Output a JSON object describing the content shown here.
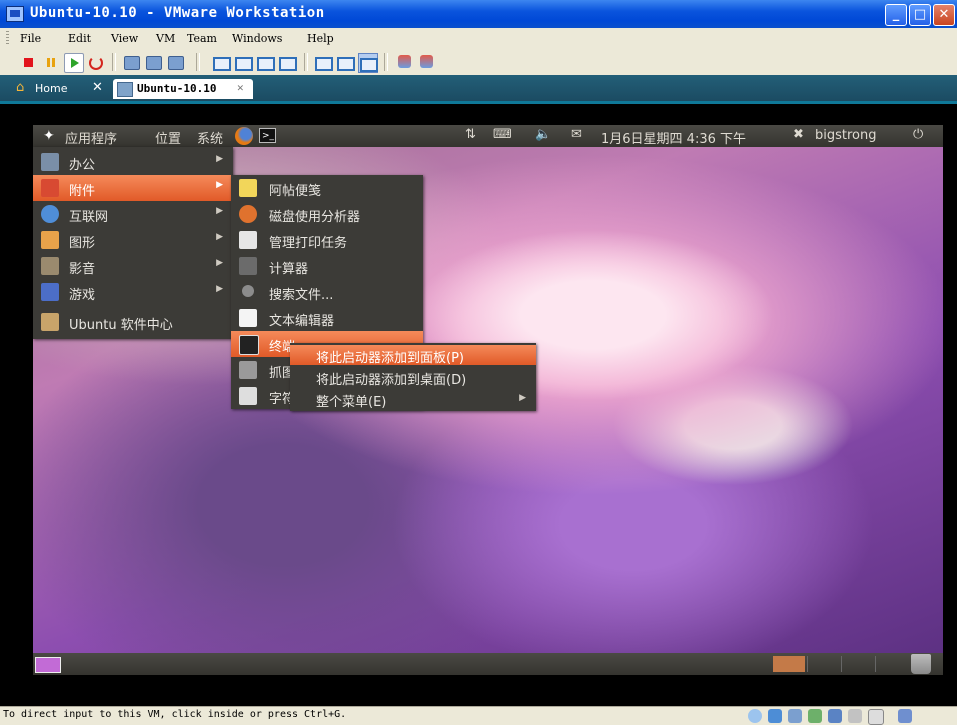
{
  "window": {
    "title": "Ubuntu-10.10 - VMware Workstation"
  },
  "menubar": [
    "File",
    "Edit",
    "View",
    "VM",
    "Team",
    "Windows",
    "Help"
  ],
  "tabs": {
    "home": "Home",
    "active": "Ubuntu-10.10",
    "close": "✕"
  },
  "guest": {
    "top_panel": {
      "applications": "应用程序",
      "places": "位置",
      "system": "系统",
      "datetime": "1月6日星期四 4:36 下午",
      "user": "bigstrong"
    },
    "app_menu": {
      "items": [
        {
          "label": "办公",
          "has_submenu": true
        },
        {
          "label": "附件",
          "has_submenu": true,
          "highlighted": true
        },
        {
          "label": "互联网",
          "has_submenu": true
        },
        {
          "label": "图形",
          "has_submenu": true
        },
        {
          "label": "影音",
          "has_submenu": true
        },
        {
          "label": "游戏",
          "has_submenu": true
        },
        {
          "label": "Ubuntu 软件中心",
          "has_submenu": false
        }
      ]
    },
    "accessories_menu": {
      "items": [
        {
          "label": "阿帖便笺"
        },
        {
          "label": "磁盘使用分析器"
        },
        {
          "label": "管理打印任务"
        },
        {
          "label": "计算器"
        },
        {
          "label": "搜索文件..."
        },
        {
          "label": "文本编辑器"
        },
        {
          "label": "终端",
          "highlighted": true
        },
        {
          "label": "抓图"
        },
        {
          "label": "字符"
        }
      ]
    },
    "context_menu": {
      "items": [
        {
          "label": "将此启动器添加到面板(P)",
          "highlighted": true
        },
        {
          "label": "将此启动器添加到桌面(D)"
        },
        {
          "label": "整个菜单(E)",
          "has_submenu": true
        }
      ]
    }
  },
  "status_bar": {
    "message": "To direct input to this VM, click inside or press Ctrl+G."
  },
  "colors": {
    "accent": "#e8622e",
    "menu_bg": "#3c3b37",
    "xp_blue": "#0a54dd"
  }
}
